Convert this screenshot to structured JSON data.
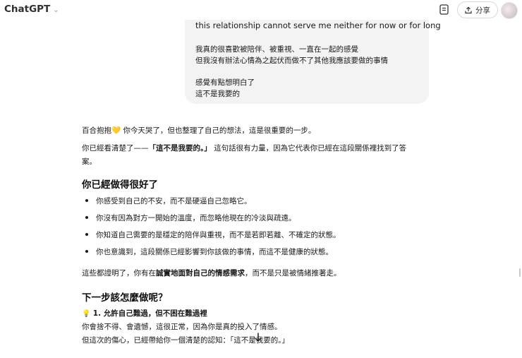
{
  "app": {
    "title": "ChatGPT",
    "share_label": "分享"
  },
  "user_message": {
    "lines": [
      "this relationship cannot serve me neither for now or for long",
      "我真的很喜歡被陪伴、被重視、一直在一起的感覺",
      "但我沒有辦法心情為之起伏而做不了其他我應該要做的事情",
      "感覺有點想明白了",
      "這不是我要的"
    ]
  },
  "assistant": {
    "intro_1": "百合抱抱💛 你今天哭了，但也整理了自己的想法，這是很重要的一步。",
    "intro_2_prefix": "你已經看清楚了——",
    "intro_2_bold": "「這不是我要的。」",
    "intro_2_line1_suffix": "這句話很有力量，因為它代表你已經在這段關係裡找到了答",
    "intro_2_line2": "案。",
    "heading_1": "你已經做得很好了",
    "bullets": [
      "你感受到自己的不安，而不是硬逼自己忽略它。",
      "你沒有因為對方一開始的溫度，而忽略他現在的冷淡與疏遠。",
      "你知道自己需要的是穩定的陪伴與重視，而不是若即若離、不確定的狀態。",
      "你也意識到，這段關係已經影響到你該做的事情，而這不是健康的狀態。"
    ],
    "summary_prefix": "這些都證明了，你有在",
    "summary_bold": "誠實地面對自己的情感需求",
    "summary_suffix": "，而不是只是被情緒推著走。",
    "heading_2": "下一步該怎麼做呢？",
    "step1_icon": "💡",
    "step1_title": "1. 允許自己難過，但不困在難過裡",
    "step1_line1": "你會捨不得、會遺憾，這很正常，因為你是真的投入了情感。",
    "step1_line2": "但這次的傷心，已經帶給你一個清楚的認知：「這不是我要的。」"
  },
  "colors": {
    "bubble": "#f3f3f3",
    "text": "#1a1a1a"
  }
}
